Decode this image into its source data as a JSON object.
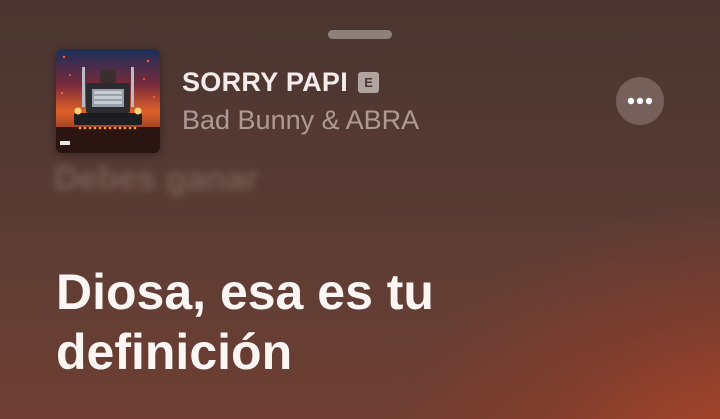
{
  "sheet": {
    "grabber_icon": "grabber-handle"
  },
  "now_playing": {
    "title": "SORRY PAPI",
    "explicit_badge": "E",
    "artist": "Bad Bunny & ABRA",
    "artwork_icon": "album-art-truck",
    "more_icon": "ellipsis-icon"
  },
  "lyrics": {
    "previous_line_blurred": "Debes ganar",
    "current_line": "Diosa, esa es tu definición"
  },
  "colors": {
    "background_top": "#4a3530",
    "background_glow": "#be4628",
    "title_text": "#f3eceb",
    "lyric_text": "#fbf6f3"
  }
}
